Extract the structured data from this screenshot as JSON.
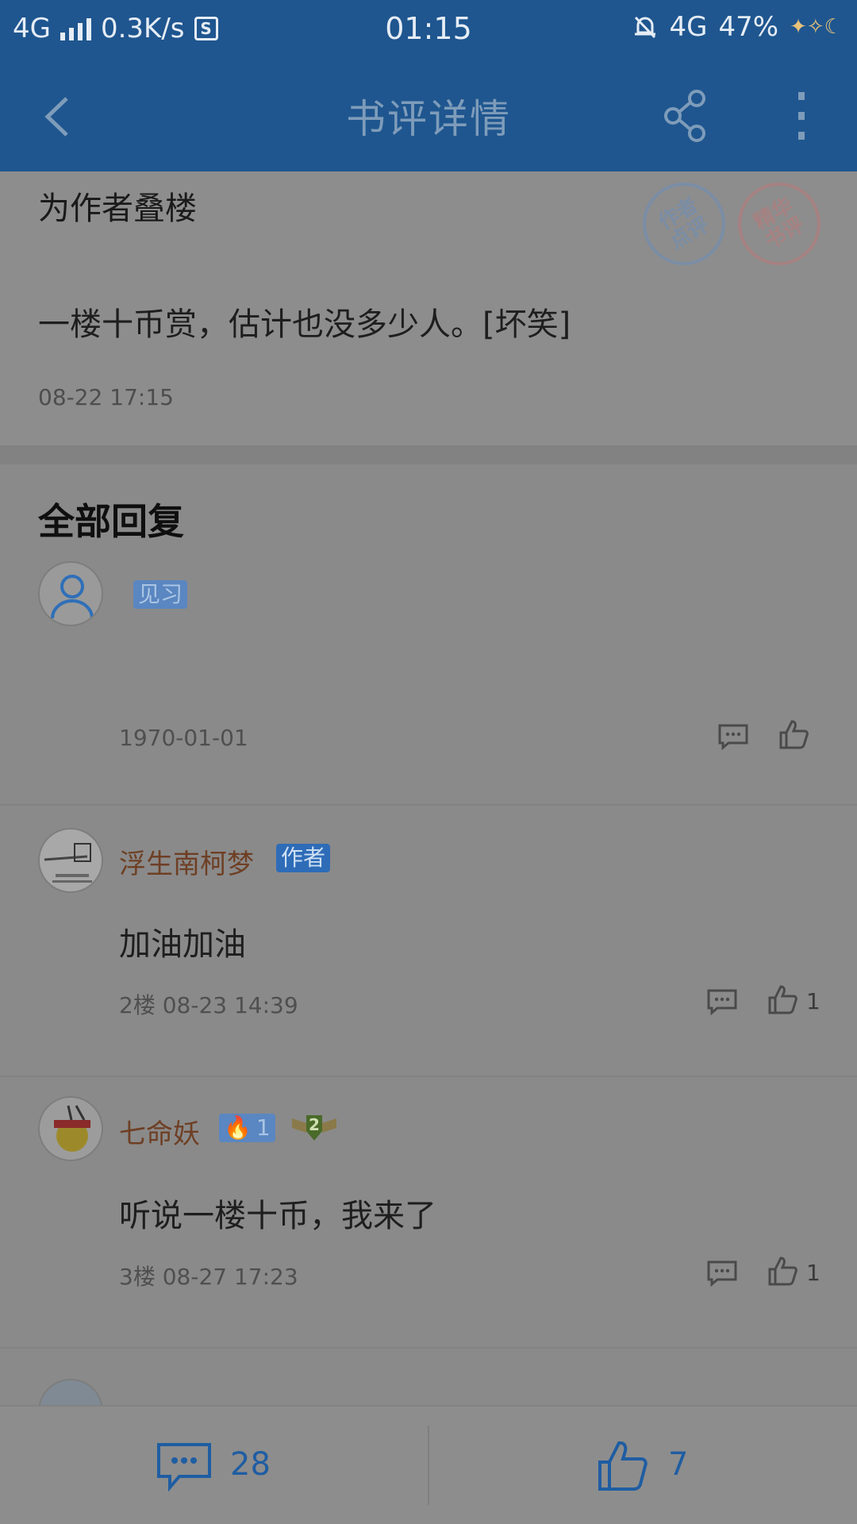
{
  "status_bar": {
    "network": "4G",
    "speed": "0.3K/s",
    "time": "01:15",
    "network_right": "4G",
    "battery": "47%"
  },
  "app_bar": {
    "title": "书评详情",
    "back_icon": "chevron-left-icon",
    "share_icon": "share-icon",
    "more_icon": "more-vertical-icon"
  },
  "post": {
    "title": "为作者叠楼",
    "stamp_author": "作者\n点评",
    "stamp_essence": "精华\n书评",
    "body": "一楼十币赏，估计也没多少人。[坏笑]",
    "time": "08-22 17:15"
  },
  "replies": {
    "title": "全部回复",
    "items": [
      {
        "name": "",
        "badge": "见习",
        "text": "",
        "meta": "1970-01-01",
        "likes": ""
      },
      {
        "name": "浮生南柯梦",
        "badge": "作者",
        "text": "加油加油",
        "meta": "2楼 08-23 14:39",
        "likes": "1"
      },
      {
        "name": "七命妖",
        "badge": "1",
        "badge_extra": "2",
        "text": "听说一楼十币，我来了",
        "meta": "3楼 08-27 17:23",
        "likes": "1"
      }
    ]
  },
  "bottom_bar": {
    "comment_count": "28",
    "like_count": "7"
  },
  "colors": {
    "header_blue": "#1f568f",
    "accent_blue": "#1f5da2",
    "username_brown": "#6e3f24"
  }
}
